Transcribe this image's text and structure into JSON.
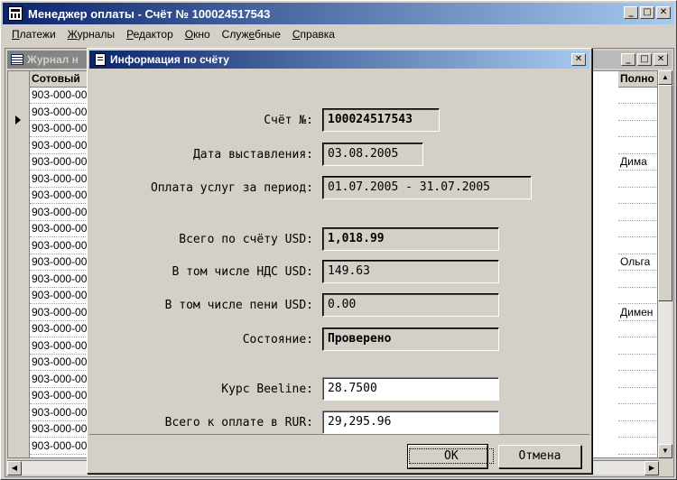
{
  "app": {
    "title": "Менеджер оплаты - Счёт № 100024517543",
    "menu": [
      {
        "label": "Платежи",
        "ul": "П",
        "rest": "латежи"
      },
      {
        "label": "Журналы",
        "ul": "Ж",
        "rest": "урналы"
      },
      {
        "label": "Редактор",
        "ul": "Р",
        "rest": "едактор"
      },
      {
        "label": "Окно",
        "ul": "О",
        "rest": "кно"
      },
      {
        "label": "Служебные",
        "pre": "Служ",
        "ul": "е",
        "rest": "бные"
      },
      {
        "label": "Справка",
        "ul": "С",
        "rest": "правка"
      }
    ]
  },
  "journal": {
    "title": "Журнал н",
    "col_phone": "Сотовый",
    "col_full": "Полно",
    "rows": [
      "903-000-00",
      "903-000-00",
      "903-000-00",
      "903-000-00",
      "903-000-00",
      "903-000-00",
      "903-000-00",
      "903-000-00",
      "903-000-00",
      "903-000-00",
      "903-000-00",
      "903-000-00",
      "903-000-00",
      "903-000-00",
      "903-000-00",
      "903-000-00",
      "903-000-00",
      "903-000-00",
      "903-000-00",
      "903-000-00",
      "903-000-00",
      "903-000-00"
    ],
    "names": {
      "4": "Дима",
      "10": "Ольга",
      "13": "Димен"
    }
  },
  "dialog": {
    "title": "Информация по счёту",
    "fields": {
      "invoice_label": "Счёт №:",
      "invoice_value": "100024517543",
      "issue_date_label": "Дата выставления:",
      "issue_date_value": "03.08.2005",
      "period_label": "Оплата услуг за период:",
      "period_value": "01.07.2005 - 31.07.2005",
      "total_label": "Всего по счёту USD:",
      "total_value": "1,018.99",
      "vat_label": "В том числе НДС USD:",
      "vat_value": "149.63",
      "penalty_label": "В том числе пени USD:",
      "penalty_value": "0.00",
      "status_label": "Состояние:",
      "status_value": "Проверено",
      "rate_label": "Курс Beeline:",
      "rate_value": "28.7500",
      "rur_label": "Всего к оплате в RUR:",
      "rur_value": "29,295.96"
    },
    "ok_label": "OK",
    "cancel_label": "Отмена"
  },
  "buttons": {
    "minimize": "_",
    "maximize": "□",
    "close": "✕"
  }
}
